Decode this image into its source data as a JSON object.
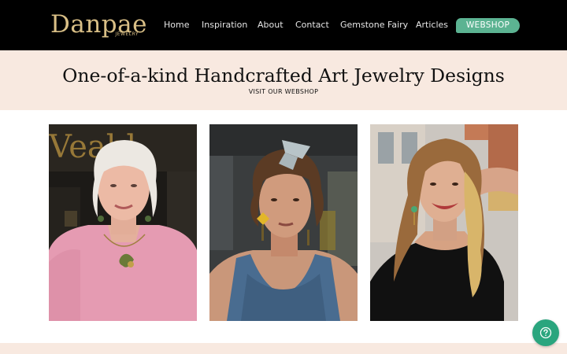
{
  "brand": {
    "name": "Danpae",
    "subtitle": "JEWELRY",
    "color": "#d9bf86"
  },
  "nav": {
    "items": [
      "Home",
      "Inspiration",
      "About",
      "Contact",
      "Gemstone Fairy",
      "Articles"
    ],
    "cta": {
      "label": "WEBSHOP",
      "color": "#5cb392"
    }
  },
  "hero": {
    "title": "One-of-a-kind Handcrafted Art Jewelry Designs",
    "link": "VISIT OUR WEBSHOP",
    "background": "#f8e9e0"
  },
  "photos": [
    {
      "subject": "older woman with white hair in pink sweater wearing pendant necklace and earrings"
    },
    {
      "subject": "young woman with curly hair and sunglasses on head wearing yellow flower earrings"
    },
    {
      "subject": "smiling young woman with long wavy hair wearing green drop earrings"
    }
  ],
  "help": {
    "icon": "question-icon",
    "color": "#2aa57e"
  }
}
